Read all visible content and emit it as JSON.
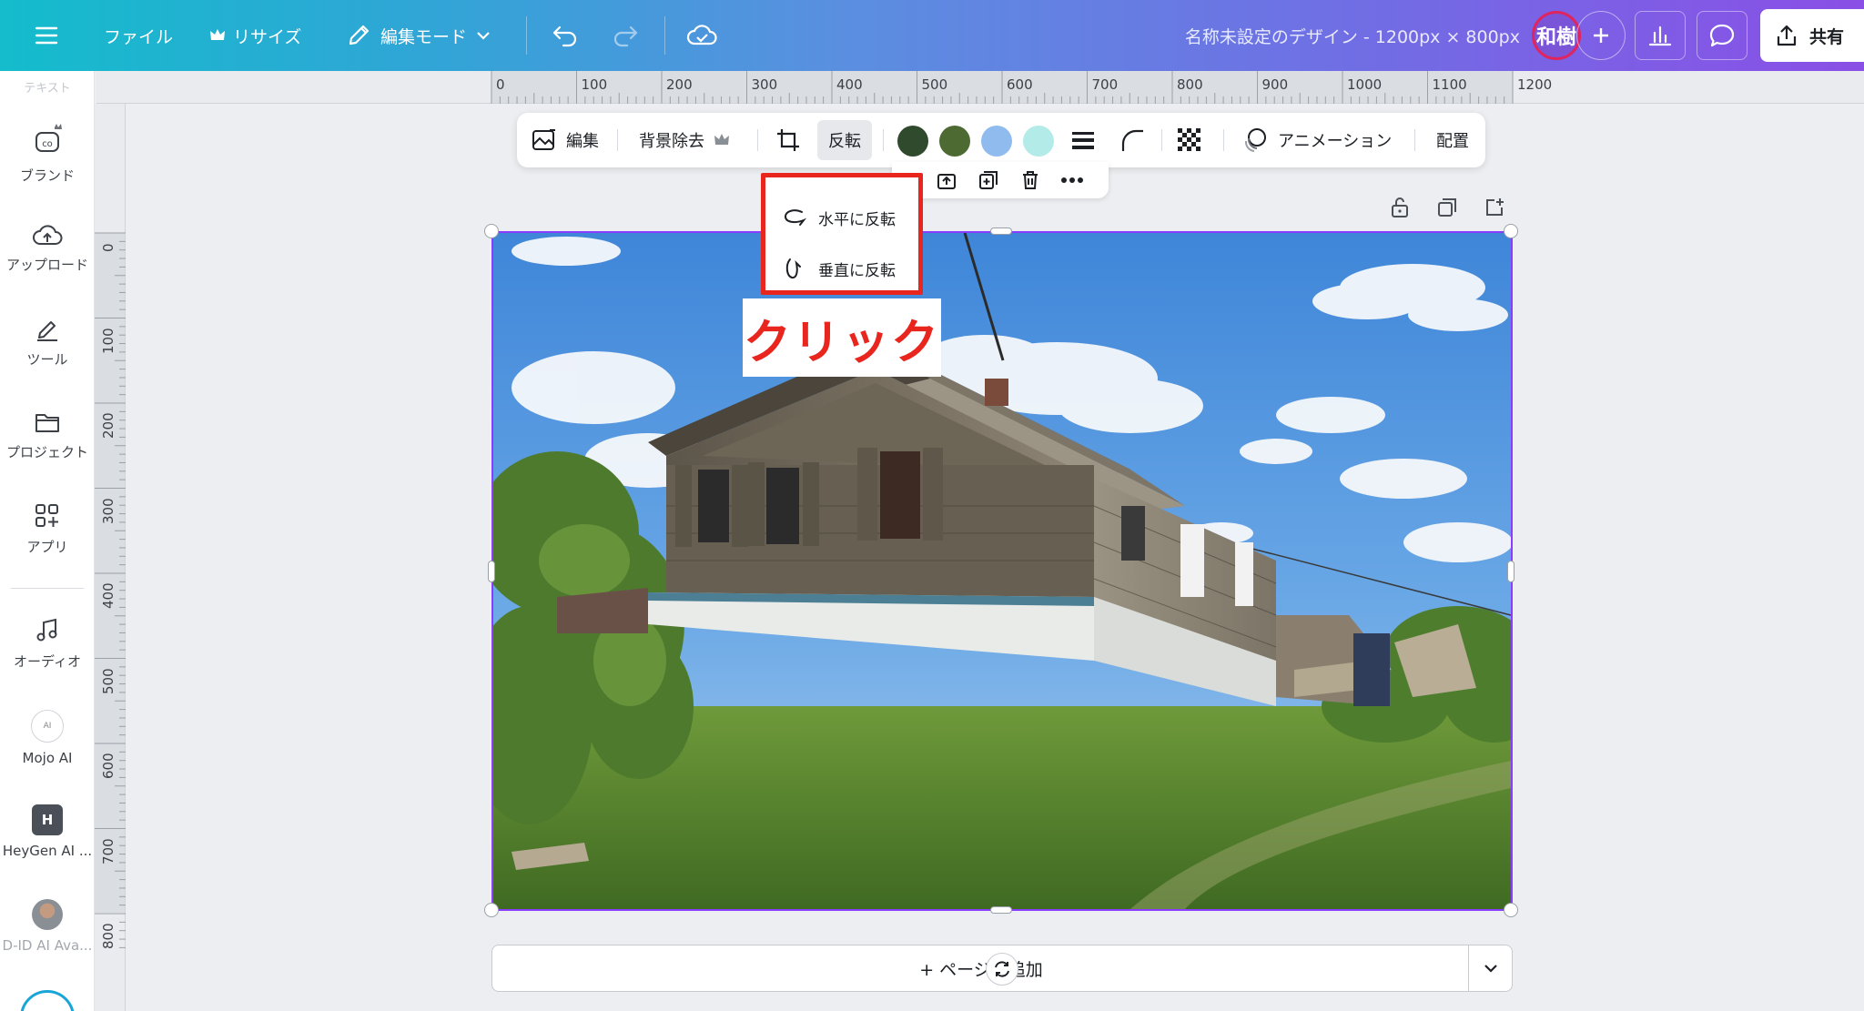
{
  "topbar": {
    "file_label": "ファイル",
    "resize_label": "リサイズ",
    "edit_mode_label": "編集モード",
    "design_title": "名称未設定のデザイン - 1200px × 800px",
    "avatar_text": "和樹",
    "share_label": "共有"
  },
  "sidebar": {
    "faded_label": "テキスト",
    "items": [
      {
        "label": "ブランド"
      },
      {
        "label": "アップロード"
      },
      {
        "label": "ツール"
      },
      {
        "label": "プロジェクト"
      },
      {
        "label": "アプリ"
      },
      {
        "label": "オーディオ"
      },
      {
        "label": "Mojo AI"
      },
      {
        "label": "HeyGen AI ..."
      },
      {
        "label": "D-ID AI Ava..."
      }
    ]
  },
  "rulers": {
    "horizontal": [
      "0",
      "100",
      "200",
      "300",
      "400",
      "500",
      "600",
      "700",
      "800",
      "900",
      "1000",
      "1100",
      "1200"
    ],
    "vertical": [
      "0",
      "100",
      "200",
      "300",
      "400",
      "500",
      "600",
      "700",
      "800"
    ]
  },
  "image_toolbar": {
    "edit_label": "編集",
    "bg_remove_label": "背景除去",
    "flip_label": "反転",
    "animation_label": "アニメーション",
    "position_label": "配置",
    "colors": [
      "#2f4a2c",
      "#4d6a32",
      "#8fbbef",
      "#b3ebe8"
    ]
  },
  "flip_menu": {
    "horizontal_label": "水平に反転",
    "vertical_label": "垂直に反転"
  },
  "callout": {
    "text": "クリック",
    "color": "#e8261e"
  },
  "add_page": {
    "label": "+ ページを追加"
  },
  "accent": {
    "selection": "#8b3dff"
  }
}
